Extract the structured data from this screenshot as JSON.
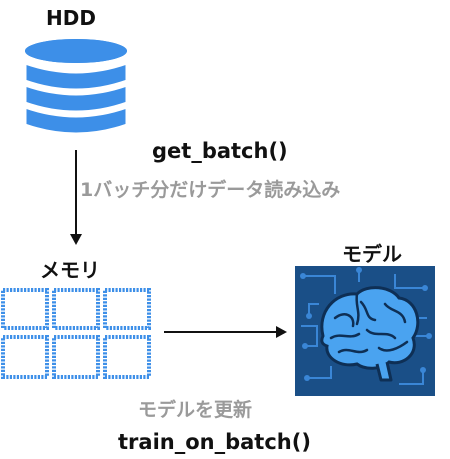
{
  "hdd": {
    "title": "HDD"
  },
  "memory": {
    "title": "メモリ"
  },
  "model": {
    "title": "モデル"
  },
  "steps": {
    "get_batch": "get_batch()",
    "read_note": "1バッチ分だけデータ読み込み",
    "update_note": "モデルを更新",
    "train_on_batch": "train_on_batch()"
  },
  "colors": {
    "accent": "#3d8fe8",
    "chip_bg": "#1a4f87",
    "text": "#111111",
    "note": "#9a9a9a"
  },
  "icons": {
    "hdd": "database-icon",
    "memory": "memory-grid-icon",
    "model": "brain-chip-icon"
  }
}
